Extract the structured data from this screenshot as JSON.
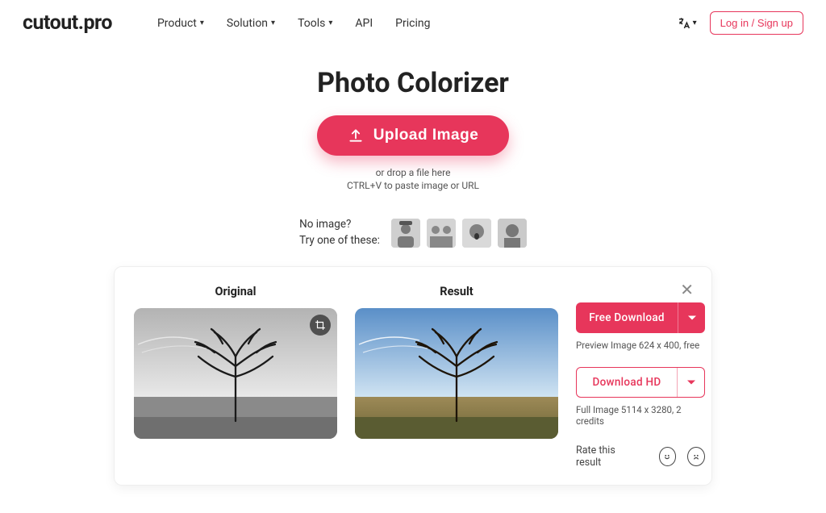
{
  "brand": "cutout.pro",
  "nav": {
    "product": "Product",
    "solution": "Solution",
    "tools": "Tools",
    "api": "API",
    "pricing": "Pricing"
  },
  "header": {
    "login": "Log in / Sign up"
  },
  "hero": {
    "title": "Photo Colorizer",
    "upload": "Upload Image",
    "drop": "or drop a file here",
    "paste": "CTRL+V to paste image or URL",
    "no_image": "No image?",
    "try_these": "Try one of these:"
  },
  "result": {
    "original_label": "Original",
    "result_label": "Result",
    "free_download": "Free Download",
    "preview_info": "Preview Image 624 x 400, free",
    "download_hd": "Download HD",
    "full_info": "Full Image 5114 x 3280, 2 credits",
    "rate_label": "Rate this result"
  },
  "colors": {
    "accent": "#e7365b"
  }
}
